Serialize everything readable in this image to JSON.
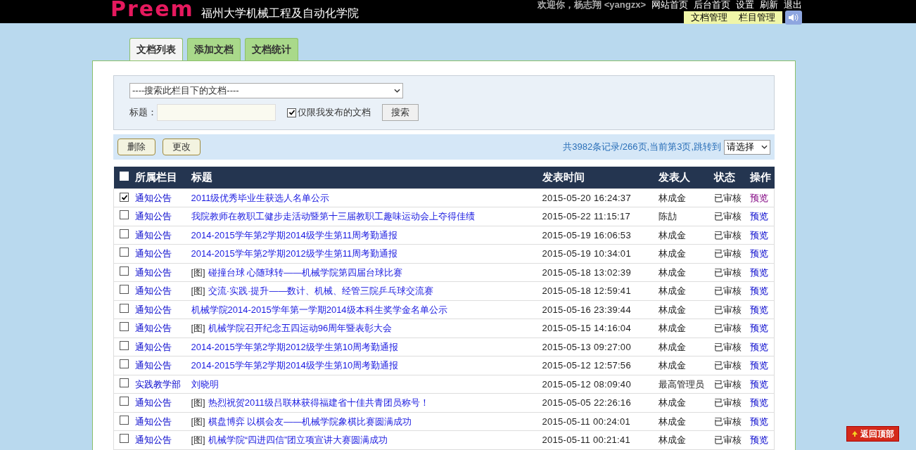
{
  "header": {
    "logo": "Preem",
    "site_title": "福州大学机械工程及自动化学院",
    "welcome": "欢迎你，杨志翔 <yangzx>",
    "top_links": [
      "网站首页",
      "后台首页",
      "设置",
      "刷新",
      "退出"
    ],
    "sub_links": [
      "文档管理",
      "栏目管理"
    ]
  },
  "tabs": [
    {
      "label": "文档列表",
      "selected": true
    },
    {
      "label": "添加文档",
      "selected": false
    },
    {
      "label": "文档统计",
      "selected": false
    }
  ],
  "search": {
    "category_select": "----搜索此栏目下的文档----",
    "title_label": "标题：",
    "only_mine": {
      "label": "仅限我发布的文档",
      "checked": true
    },
    "search_button": "搜索"
  },
  "actions": {
    "buttons": [
      "删除",
      "更改"
    ],
    "summary": "共3982条记录/266页,当前第3页,跳转到",
    "page_select": "请选择"
  },
  "table": {
    "all_checked": false,
    "columns": [
      "所属栏目",
      "标题",
      "发表时间",
      "发表人",
      "状态",
      "操作"
    ],
    "rows": [
      {
        "checked": true,
        "column": "通知公告",
        "tag": "",
        "title": "2011级优秀毕业生获选人名单公示",
        "time": "2015-05-20 16:24:37",
        "author": "林成金",
        "status": "已审核",
        "action": "预览",
        "visited": true
      },
      {
        "checked": false,
        "column": "通知公告",
        "tag": "",
        "title": "我院教师在教职工健步走活动暨第十三届教职工趣味运动会上夺得佳绩",
        "time": "2015-05-22 11:15:17",
        "author": "陈劼",
        "status": "已审核",
        "action": "预览",
        "visited": false
      },
      {
        "checked": false,
        "column": "通知公告",
        "tag": "",
        "title": "2014-2015学年第2学期2014级学生第11周考勤通报",
        "time": "2015-05-19 16:06:53",
        "author": "林成金",
        "status": "已审核",
        "action": "预览",
        "visited": false
      },
      {
        "checked": false,
        "column": "通知公告",
        "tag": "",
        "title": "2014-2015学年第2学期2012级学生第11周考勤通报",
        "time": "2015-05-19 10:34:01",
        "author": "林成金",
        "status": "已审核",
        "action": "预览",
        "visited": false
      },
      {
        "checked": false,
        "column": "通知公告",
        "tag": "[图]",
        "title": "碰撞台球 心随球转——机械学院第四届台球比赛",
        "time": "2015-05-18 13:02:39",
        "author": "林成金",
        "status": "已审核",
        "action": "预览",
        "visited": false
      },
      {
        "checked": false,
        "column": "通知公告",
        "tag": "[图]",
        "title": "交流·实践·提升——数计、机械、经管三院乒乓球交流赛",
        "time": "2015-05-18 12:59:41",
        "author": "林成金",
        "status": "已审核",
        "action": "预览",
        "visited": false
      },
      {
        "checked": false,
        "column": "通知公告",
        "tag": "",
        "title": "机械学院2014-2015学年第一学期2014级本科生奖学金名单公示",
        "time": "2015-05-16 23:39:44",
        "author": "林成金",
        "status": "已审核",
        "action": "预览",
        "visited": false
      },
      {
        "checked": false,
        "column": "通知公告",
        "tag": "[图]",
        "title": "机械学院召开纪念五四运动96周年暨表彰大会",
        "time": "2015-05-15 14:16:04",
        "author": "林成金",
        "status": "已审核",
        "action": "预览",
        "visited": false
      },
      {
        "checked": false,
        "column": "通知公告",
        "tag": "",
        "title": "2014-2015学年第2学期2012级学生第10周考勤通报",
        "time": "2015-05-13 09:27:00",
        "author": "林成金",
        "status": "已审核",
        "action": "预览",
        "visited": false
      },
      {
        "checked": false,
        "column": "通知公告",
        "tag": "",
        "title": "2014-2015学年第2学期2014级学生第10周考勤通报",
        "time": "2015-05-12 12:57:56",
        "author": "林成金",
        "status": "已审核",
        "action": "预览",
        "visited": false
      },
      {
        "checked": false,
        "column": "实践教学部",
        "tag": "",
        "title": "刘晓明",
        "time": "2015-05-12 08:09:40",
        "author": "最高管理员",
        "status": "已审核",
        "action": "预览",
        "visited": false
      },
      {
        "checked": false,
        "column": "通知公告",
        "tag": "[图]",
        "title": "热烈祝贺2011级吕联林获得福建省十佳共青团员称号！",
        "time": "2015-05-05 22:26:16",
        "author": "林成金",
        "status": "已审核",
        "action": "预览",
        "visited": false
      },
      {
        "checked": false,
        "column": "通知公告",
        "tag": "[图]",
        "title": "棋盘博弈 以棋会友——机械学院象棋比赛圆满成功",
        "time": "2015-05-11 00:24:01",
        "author": "林成金",
        "status": "已审核",
        "action": "预览",
        "visited": false
      },
      {
        "checked": false,
        "column": "通知公告",
        "tag": "[图]",
        "title": "机械学院“四进四信”团立项宣讲大赛圆满成功",
        "time": "2015-05-11 00:21:41",
        "author": "林成金",
        "status": "已审核",
        "action": "预览",
        "visited": false
      }
    ]
  },
  "back_to_top": "返回顶部"
}
